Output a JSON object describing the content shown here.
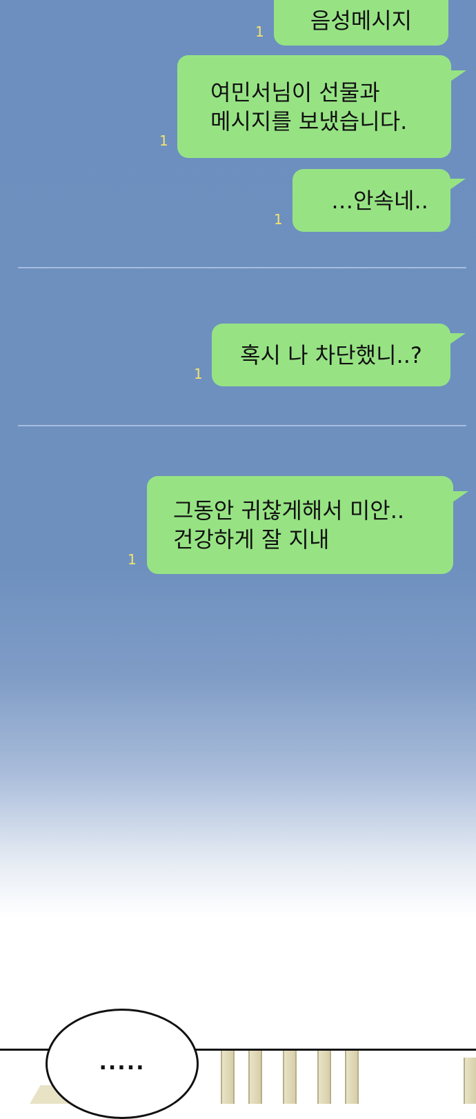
{
  "messages": [
    {
      "text": "음성메시지",
      "read_count": "1"
    },
    {
      "text": "여민서님이 선물과\n메시지를 보냈습니다.",
      "read_count": "1"
    },
    {
      "text": "…안속네..",
      "read_count": "1"
    },
    {
      "text": "혹시 나 차단했니..?",
      "read_count": "1"
    },
    {
      "text": "그동안 귀찮게해서 미안..\n건강하게 잘 지내",
      "read_count": "1"
    }
  ],
  "speech_bubble": {
    "text": "....."
  },
  "colors": {
    "chat_background": "#6c8fbf",
    "bubble": "#97e384",
    "read_count": "#f5e36b",
    "divider": "#a8bcdd"
  }
}
